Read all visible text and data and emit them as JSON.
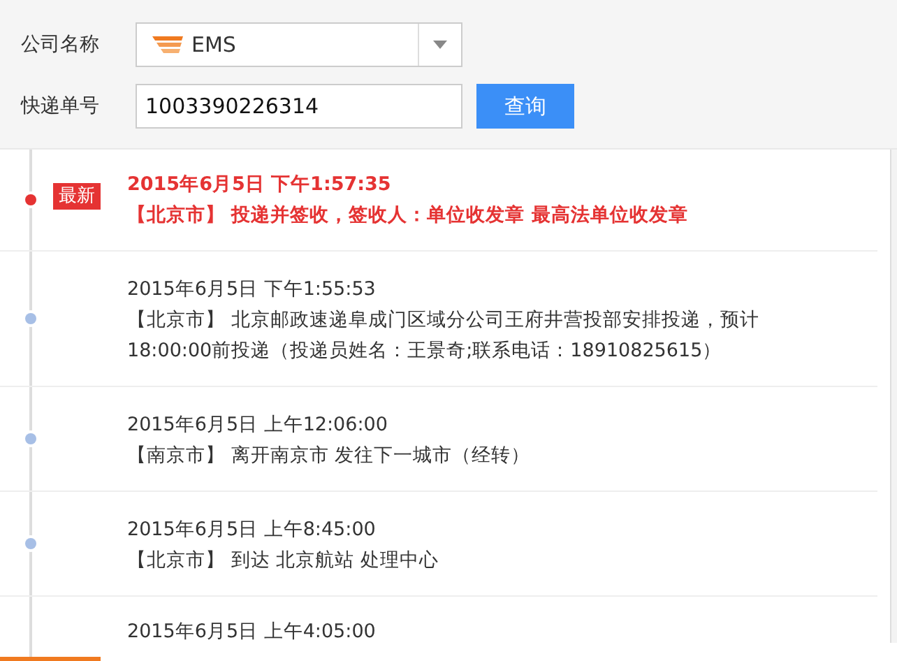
{
  "form": {
    "company_label": "公司名称",
    "company_value": "EMS",
    "number_label": "快递单号",
    "number_value": "1003390226314",
    "query_button": "查询"
  },
  "events": [
    {
      "latest": true,
      "badge": "最新",
      "time": "2015年6月5日 下午1:57:35",
      "text": "【北京市】 投递并签收，签收人：单位收发章 最高法单位收发章"
    },
    {
      "latest": false,
      "time": "2015年6月5日 下午1:55:53",
      "text": "【北京市】 北京邮政速递阜成门区域分公司王府井营投部安排投递，预计18:00:00前投递（投递员姓名：王景奇;联系电话：18910825615）"
    },
    {
      "latest": false,
      "time": "2015年6月5日 上午12:06:00",
      "text": "【南京市】 离开南京市 发往下一城市（经转）"
    },
    {
      "latest": false,
      "time": "2015年6月5日 上午8:45:00",
      "text": "【北京市】 到达 北京航站 处理中心"
    },
    {
      "latest": false,
      "time": "2015年6月5日 上午4:05:00"
    }
  ]
}
